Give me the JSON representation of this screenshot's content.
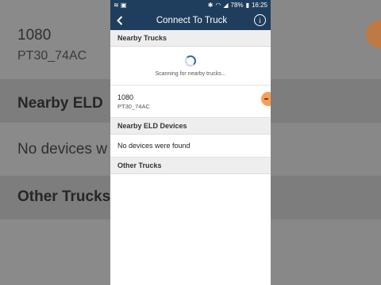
{
  "status_bar": {
    "signal_icons": "≋ ▣",
    "battery_percent": "78%",
    "time": "16:25"
  },
  "app_bar": {
    "title": "Connect To Truck",
    "back_icon": "chevron-left",
    "info_icon": "i"
  },
  "sections": {
    "nearby_trucks": "Nearby Trucks",
    "nearby_eld": "Nearby ELD Devices",
    "other_trucks": "Other Trucks"
  },
  "scan": {
    "text": "Scanning for nearby trucks..."
  },
  "trucks": [
    {
      "name": "1080",
      "id": "PT30_74AC"
    }
  ],
  "eld_empty": "No devices were found",
  "background": {
    "truck_name": "1080",
    "truck_id": "PT30_74AC",
    "nearby_eld": "Nearby ELD",
    "no_devices": "No devices w",
    "other_trucks": "Other Trucks"
  },
  "colors": {
    "appbar": "#1f3e5e",
    "accent_orange": "#f5a05a",
    "spinner": "#2d6bb0"
  }
}
